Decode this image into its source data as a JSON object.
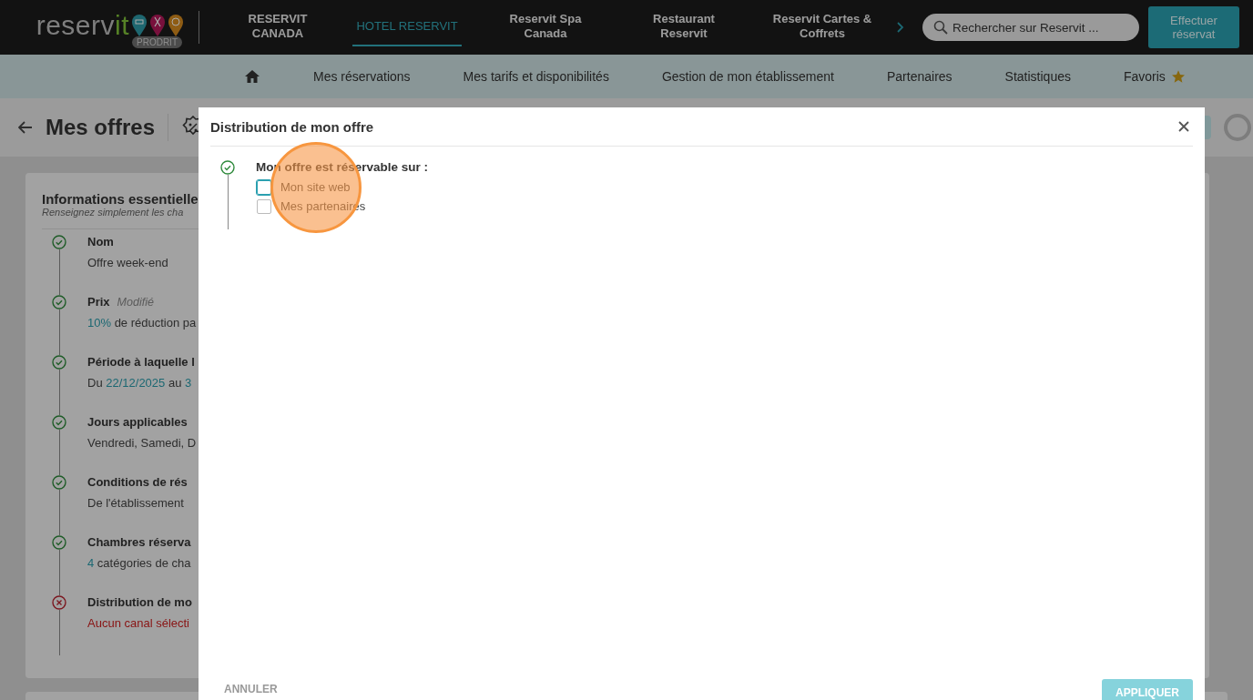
{
  "header": {
    "logo": {
      "text": "reserv",
      "accent": "it",
      "badge": "PRODRIT"
    },
    "nav": [
      {
        "label": "RESERVIT CANADA",
        "selected": false
      },
      {
        "label": "HOTEL RESERVIT",
        "selected": true
      },
      {
        "label": "Reservit Spa Canada",
        "selected": false
      },
      {
        "label": "Restaurant Reservit",
        "selected": false
      },
      {
        "label": "Reservit Cartes & Coffrets",
        "selected": false
      }
    ],
    "search": {
      "placeholder": "Rechercher sur Reservit ..."
    },
    "action_button": "Effectuer réservat"
  },
  "subnav": [
    {
      "kind": "home"
    },
    {
      "kind": "text",
      "label": "Mes réservations"
    },
    {
      "kind": "text",
      "label": "Mes tarifs et disponibilités"
    },
    {
      "kind": "text",
      "label": "Gestion de mon établissement"
    },
    {
      "kind": "text",
      "label": "Partenaires"
    },
    {
      "kind": "text",
      "label": "Statistiques"
    },
    {
      "kind": "favorite",
      "label": "Favoris"
    }
  ],
  "page": {
    "title": "Mes offres",
    "card": {
      "title": "Informations essentielle",
      "subtitle": "Renseignez simplement les cha",
      "steps": [
        {
          "complete": true,
          "title": "Nom",
          "value": [
            {
              "text": "Offre week-end",
              "highlight": false
            }
          ]
        },
        {
          "complete": true,
          "title": "Prix",
          "note": "Modifié",
          "value": [
            {
              "text": "10%",
              "highlight": true
            },
            {
              "text": " de réduction pa",
              "highlight": false
            }
          ]
        },
        {
          "complete": true,
          "title": "Période à laquelle l",
          "value": [
            {
              "text": "Du ",
              "highlight": false
            },
            {
              "text": "22/12/2025",
              "highlight": true
            },
            {
              "text": " au ",
              "highlight": false
            },
            {
              "text": "3",
              "highlight": true
            }
          ]
        },
        {
          "complete": true,
          "title": "Jours applicables",
          "value": [
            {
              "text": "Vendredi, Samedi, D",
              "highlight": false
            }
          ]
        },
        {
          "complete": true,
          "title": "Conditions de rés",
          "value": [
            {
              "text": "De l'établissement",
              "highlight": false
            }
          ]
        },
        {
          "complete": true,
          "title": "Chambres réserva",
          "value": [
            {
              "text": "4",
              "highlight": true
            },
            {
              "text": " catégories de cha",
              "highlight": false
            }
          ]
        },
        {
          "complete": false,
          "title": "Distribution de mo",
          "value": [
            {
              "text": "Aucun canal sélecti",
              "highlight": false
            }
          ]
        }
      ]
    }
  },
  "modal": {
    "title": "Distribution de mon offre",
    "complete": true,
    "question": "Mon offre est réservable sur :",
    "options": [
      {
        "label": "Mon site web",
        "checked": false,
        "focused": true
      },
      {
        "label": "Mes partenaires",
        "checked": false,
        "focused": false
      }
    ],
    "cancel": "ANNULER",
    "apply": {
      "label": "APPLIQUER",
      "disabled": true
    }
  }
}
